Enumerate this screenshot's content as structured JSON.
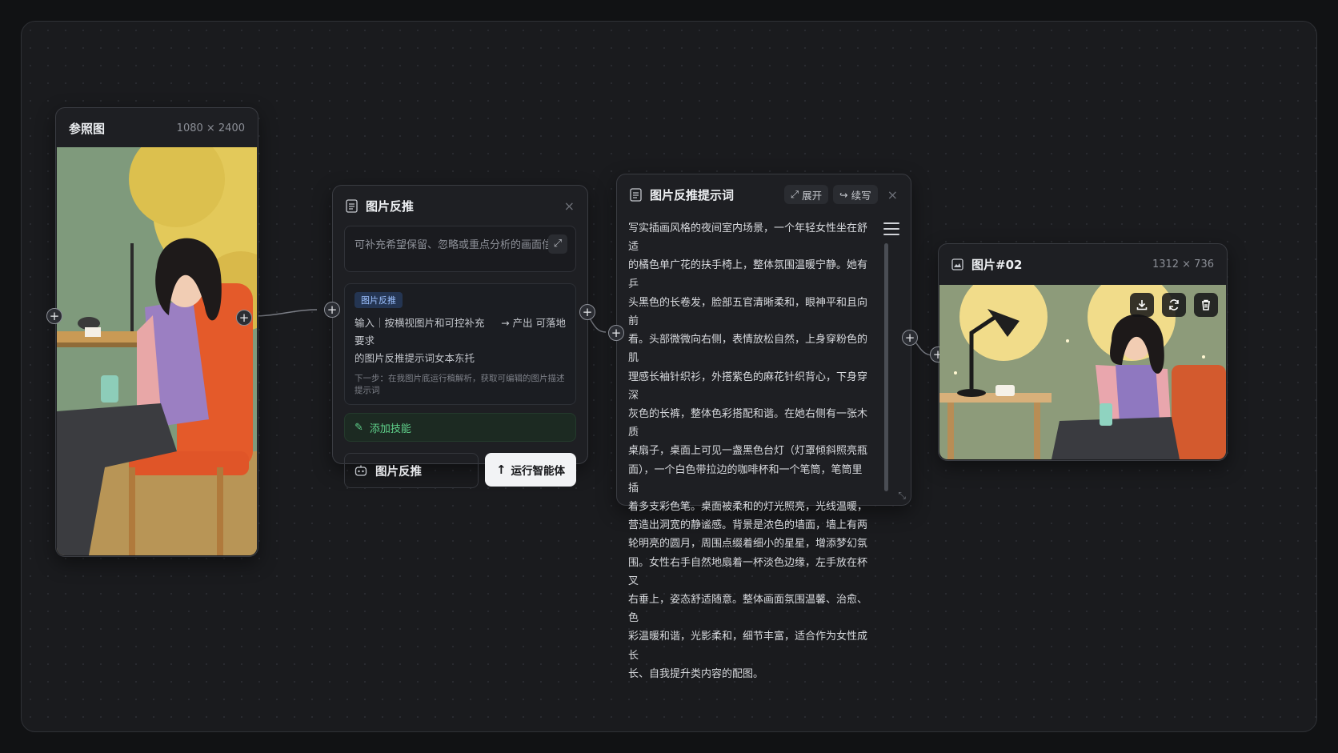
{
  "reference_node": {
    "title": "参照图",
    "dims": "1080 × 2400"
  },
  "prompt_node": {
    "title": "图片反推",
    "hint_placeholder": "可补充希望保留、忽略或重点分析的画面信息",
    "skill_tag": "图片反推",
    "skill_input": "输入｜按横视图片和可控补充要求",
    "skill_output": "→ 产出 可落地",
    "skill_input_cont": "的图片反推提示词女本东托",
    "next_step": "下一步：在我图片底运行稿解析，获取可编辑的图片描述提示词",
    "add_skill_label": "添加技能",
    "agent_label": "图片反推",
    "run_label": "运行智能体"
  },
  "text_node": {
    "title": "图片反推提示词",
    "expand_label": "展开",
    "continue_label": "续写",
    "lines": [
      "写实插画风格的夜间室内场景，一个年轻女性坐在舒适",
      "的橘色单广花的扶手椅上，整体氛围温暖宁静。她有乒",
      "头黑色的长卷发，脸部五官清晰柔和，眼神平和且向前",
      "看。头部微微向右侧，表情放松自然，上身穿粉色的肌",
      "理感长袖针织衫，外搭紫色的麻花针织背心，下身穿深",
      "灰色的长裤，整体色彩搭配和谐。在她右侧有一张木质",
      "桌扇子，桌面上可见一盏黑色台灯（灯罩倾斜照亮瓶",
      "面），一个白色带拉边的咖啡杯和一个笔筒，笔筒里插",
      "着多支彩色笔。桌面被柔和的灯光照亮，光线温暖，",
      "营造出洞宽的静谧感。背景是浓色的墙面，墙上有两",
      "轮明亮的圆月，周围点缀着细小的星星，增添梦幻氛",
      "围。女性右手自然地扇着一杯淡色边缘，左手放在杯叉",
      "右垂上，姿态舒适随意。整体画面氛围温馨、治愈、色",
      "彩温暖和谐，光影柔和，细节丰富，适合作为女性成长",
      "长、自我提升类内容的配图。"
    ]
  },
  "output_node": {
    "title": "图片#02",
    "dims": "1312 × 736"
  },
  "icons": {
    "doc": "document-icon",
    "expand": "expand-icon",
    "skill": "skill-icon",
    "agent": "robot-icon",
    "run": "arrow-up-icon",
    "download": "download-icon",
    "refresh": "refresh-icon",
    "delete": "trash-icon",
    "image": "image-icon",
    "menu": "menu-icon",
    "plus": "plus-icon"
  },
  "colors": {
    "accent_green": "#5fd08a",
    "tag_blue": "#9cc0ff",
    "background": "#1a1b1e"
  }
}
